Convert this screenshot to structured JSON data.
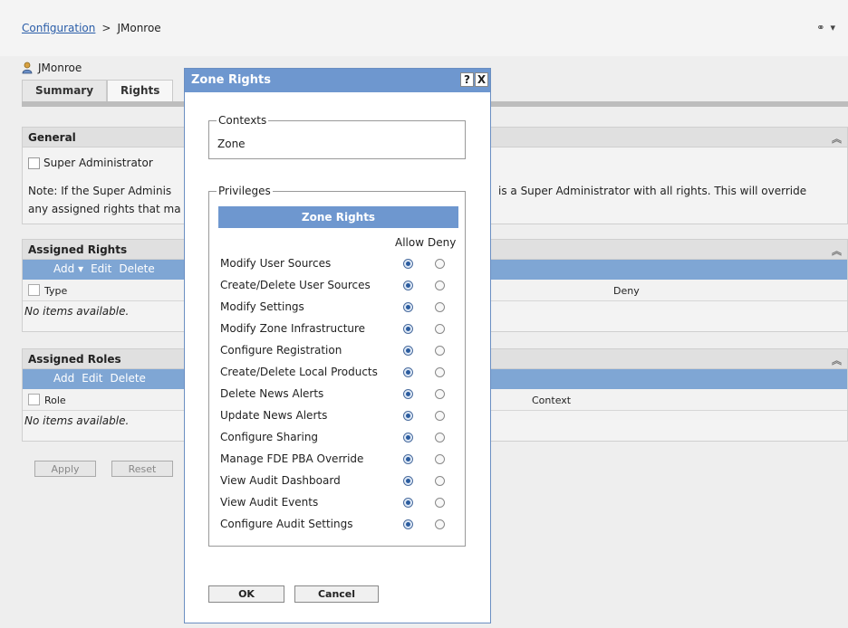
{
  "breadcrumb": {
    "parent": "Configuration",
    "separator": ">",
    "current": "JMonroe"
  },
  "header": {
    "user_name": "JMonroe"
  },
  "tabs": [
    {
      "label": "Summary"
    },
    {
      "label": "Rights"
    }
  ],
  "general": {
    "title": "General",
    "super_admin_label": "Super Administrator",
    "note_left_line1": "Note: If the Super Adminis",
    "note_right_line1": "is a Super Administrator with all rights. This will override",
    "note_left_line2": "any assigned rights that ma"
  },
  "assigned_rights": {
    "title": "Assigned Rights",
    "toolbar": {
      "add": "Add",
      "edit": "Edit",
      "delete": "Delete"
    },
    "columns": {
      "type": "Type",
      "deny": "Deny"
    },
    "empty": "No items available."
  },
  "assigned_roles": {
    "title": "Assigned Roles",
    "toolbar": {
      "add": "Add",
      "edit": "Edit",
      "delete": "Delete"
    },
    "columns": {
      "role": "Role",
      "context": "Context"
    },
    "empty": "No items available."
  },
  "page_buttons": {
    "apply": "Apply",
    "reset": "Reset"
  },
  "dialog": {
    "title": "Zone Rights",
    "help": "?",
    "close": "X",
    "contexts_legend": "Contexts",
    "context_value": "Zone",
    "privileges_legend": "Privileges",
    "zone_rights_header": "Zone Rights",
    "allow_label": "Allow",
    "deny_label": "Deny",
    "privileges": [
      {
        "label": "Modify User Sources",
        "allow": true
      },
      {
        "label": "Create/Delete User Sources",
        "allow": true
      },
      {
        "label": "Modify Settings",
        "allow": true
      },
      {
        "label": "Modify Zone Infrastructure",
        "allow": true
      },
      {
        "label": "Configure Registration",
        "allow": true
      },
      {
        "label": "Create/Delete Local Products",
        "allow": true
      },
      {
        "label": "Delete News Alerts",
        "allow": true
      },
      {
        "label": "Update News Alerts",
        "allow": true
      },
      {
        "label": "Configure Sharing",
        "allow": true
      },
      {
        "label": "Manage FDE PBA Override",
        "allow": true
      },
      {
        "label": "View Audit Dashboard",
        "allow": true
      },
      {
        "label": "View Audit Events",
        "allow": true
      },
      {
        "label": "Configure Audit Settings",
        "allow": true
      }
    ],
    "ok": "OK",
    "cancel": "Cancel"
  },
  "icons": {
    "user": "user-icon",
    "link": "link-icon",
    "dropdown": "chevron-down-icon",
    "collapse": "collapse-up-icon"
  }
}
